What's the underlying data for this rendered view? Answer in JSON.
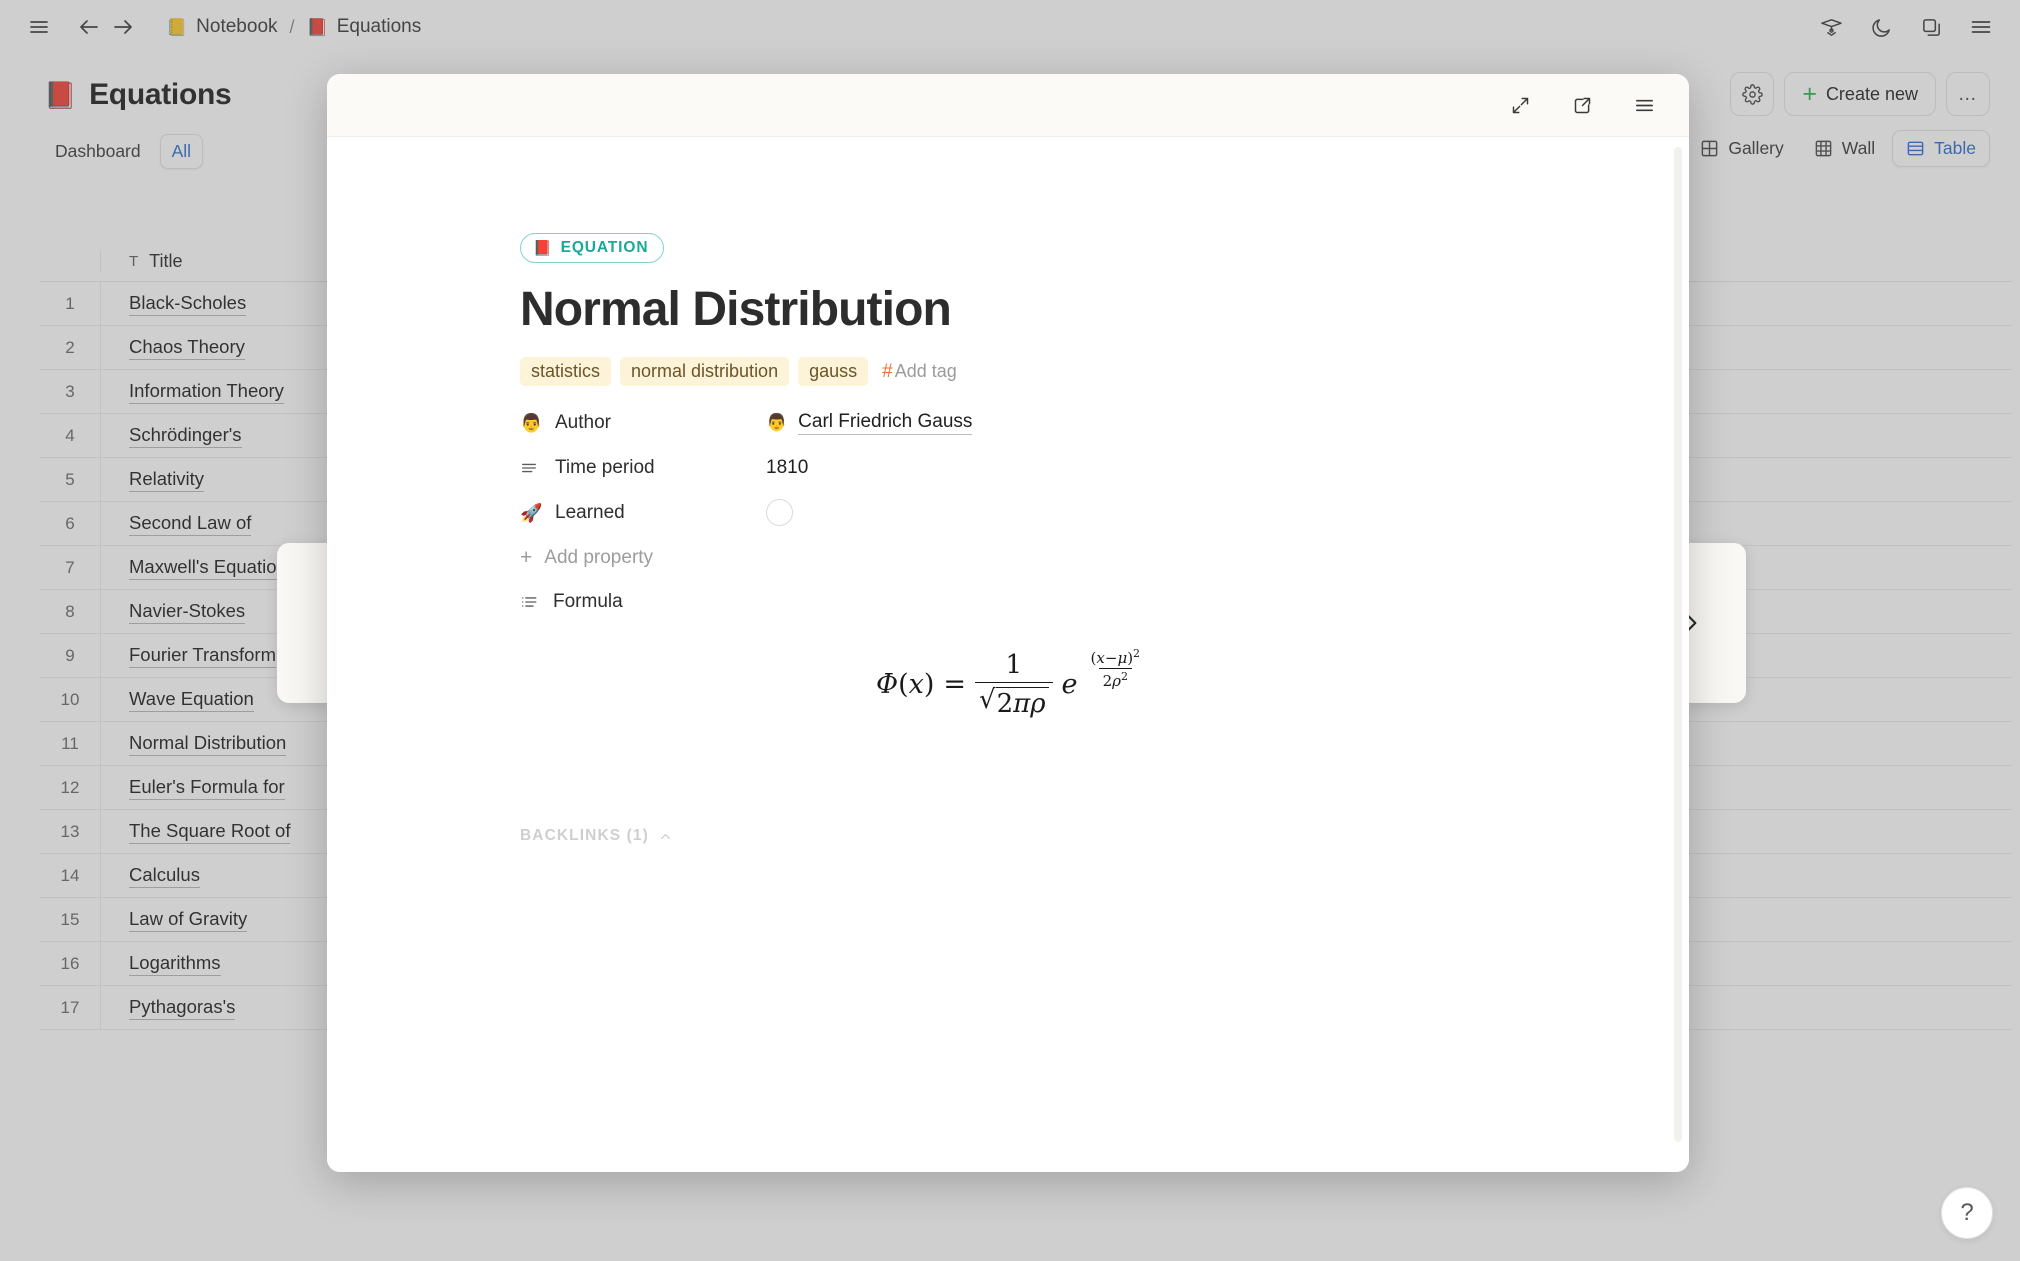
{
  "topbar": {
    "menu_icon": "hamburger-menu-icon",
    "back_icon": "arrow-left-icon",
    "forward_icon": "arrow-right-icon",
    "breadcrumbs": [
      {
        "emoji": "📒",
        "label": "Notebook"
      },
      {
        "emoji": "📕",
        "label": "Equations"
      }
    ],
    "separator": "/",
    "right_icons": [
      "graduation-cap-icon",
      "moon-icon",
      "copy-icon",
      "hamburger-menu-icon"
    ]
  },
  "database": {
    "emoji": "📕",
    "title": "Equations",
    "tabs": [
      {
        "label": "Dashboard",
        "active": false
      },
      {
        "label": "All",
        "active": true
      }
    ],
    "actions": {
      "settings_icon": "gear-icon",
      "create_label": "Create new",
      "more_label": "…"
    },
    "views": [
      {
        "label": "Gallery",
        "icon": "grid-icon",
        "active": false
      },
      {
        "label": "Wall",
        "icon": "wall-icon",
        "active": false
      },
      {
        "label": "Table",
        "icon": "table-icon",
        "active": true
      }
    ],
    "column_header": {
      "type_glyph": "T",
      "label": "Title"
    },
    "rows": [
      {
        "index": "1",
        "title": "Black-Scholes"
      },
      {
        "index": "2",
        "title": "Chaos Theory"
      },
      {
        "index": "3",
        "title": "Information Theory"
      },
      {
        "index": "4",
        "title": "Schrödinger's"
      },
      {
        "index": "5",
        "title": "Relativity"
      },
      {
        "index": "6",
        "title": "Second Law of"
      },
      {
        "index": "7",
        "title": "Maxwell's Equation"
      },
      {
        "index": "8",
        "title": "Navier-Stokes"
      },
      {
        "index": "9",
        "title": "Fourier Transform"
      },
      {
        "index": "10",
        "title": "Wave Equation"
      },
      {
        "index": "11",
        "title": "Normal Distribution"
      },
      {
        "index": "12",
        "title": "Euler's Formula for"
      },
      {
        "index": "13",
        "title": "The Square Root of"
      },
      {
        "index": "14",
        "title": "Calculus"
      },
      {
        "index": "15",
        "title": "Law of Gravity"
      },
      {
        "index": "16",
        "title": "Logarithms"
      },
      {
        "index": "17",
        "title": "Pythagoras's"
      }
    ]
  },
  "nav": {
    "prev_icon": "chevron-left-icon",
    "next_icon": "chevron-right-icon"
  },
  "modal": {
    "header_icons": [
      "expand-icon",
      "open-external-icon",
      "hamburger-menu-icon"
    ],
    "badge": {
      "emoji": "📕",
      "label": "EQUATION"
    },
    "title": "Normal Distribution",
    "tags": [
      "statistics",
      "normal distribution",
      "gauss"
    ],
    "add_tag_label": "Add tag",
    "add_tag_hash": "#",
    "properties": [
      {
        "emoji": "👨",
        "key": "Author",
        "value_emoji": "👨",
        "value": "Carl Friedrich Gauss",
        "type": "link"
      },
      {
        "emoji": "",
        "key": "Time period",
        "value": "1810",
        "type": "text",
        "icon": "lines-icon"
      },
      {
        "emoji": "🚀",
        "key": "Learned",
        "value": "",
        "type": "checkbox",
        "checked": false
      }
    ],
    "add_property_label": "Add property",
    "formula_section": {
      "label": "Formula",
      "icon": "list-icon"
    },
    "formula": {
      "lhs": "Φ(x)",
      "equals": "=",
      "numerator": "1",
      "denominator": "√2πρ",
      "exp_base": "e",
      "exp_numerator": "(x−μ)²",
      "exp_denominator": "2ρ²",
      "latex": "\\Phi(x) = \\frac{1}{\\sqrt{2\\pi\\rho}} e^{\\frac{(x-\\mu)^2}{2\\rho^2}}"
    },
    "backlinks_label": "BACKLINKS (1)",
    "backlinks_chevron": "chevron-up-icon"
  },
  "help": {
    "label": "?"
  },
  "colors": {
    "accent_blue": "#2f6fd0",
    "badge_teal": "#1aa89c",
    "tag_bg": "#fcf3d9",
    "tag_text": "#6b5529",
    "create_green": "#2bb24c",
    "hash_orange": "#e8713f",
    "overlay": "rgba(96,96,96,0.30)"
  }
}
